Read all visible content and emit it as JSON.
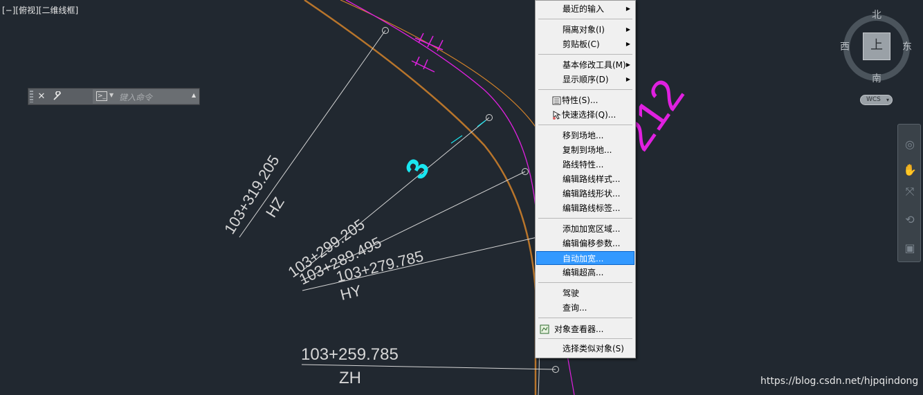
{
  "viewport": {
    "label": "[−][俯视][二维线框]"
  },
  "drawing": {
    "labels": [
      {
        "station": "103+319.205",
        "type": "HZ"
      },
      {
        "station": "103+299.205"
      },
      {
        "station": "103+289.495"
      },
      {
        "station": "103+279.785",
        "type": "HY"
      },
      {
        "station": "103+259.785",
        "type": "ZH"
      }
    ],
    "annotations": {
      "magenta_number": "212",
      "cyan_mark": "3"
    },
    "colors": {
      "background": "#212830",
      "leader_lines": "#d6d6d6",
      "road_orange": "#d2822a",
      "road_magenta": "#e020e0",
      "cyan": "#19e6f0"
    }
  },
  "command_line": {
    "close_icon": "close-icon",
    "settings_icon": "wrench-icon",
    "prompt_icon": "prompt-icon",
    "placeholder": "键入命令"
  },
  "context_menu": {
    "items": [
      {
        "label": "最近的输入",
        "submenu": true
      },
      {
        "label": "隔离对象(I)",
        "submenu": true
      },
      {
        "label": "剪贴板(C)",
        "submenu": true
      },
      {
        "label": "基本修改工具(M)",
        "submenu": true
      },
      {
        "label": "显示顺序(D)",
        "submenu": true
      },
      {
        "label": "特性(S)...",
        "icon": "properties-icon"
      },
      {
        "label": "快速选择(Q)...",
        "icon": "quick-select-icon"
      },
      {
        "label": "移到场地..."
      },
      {
        "label": "复制到场地..."
      },
      {
        "label": "路线特性..."
      },
      {
        "label": "编辑路线样式..."
      },
      {
        "label": "编辑路线形状..."
      },
      {
        "label": "编辑路线标签..."
      },
      {
        "label": "添加加宽区域..."
      },
      {
        "label": "编辑偏移参数..."
      },
      {
        "label": "自动加宽...",
        "highlighted": true
      },
      {
        "label": "编辑超高..."
      },
      {
        "label": "驾驶"
      },
      {
        "label": "查询..."
      },
      {
        "label": "对象查看器...",
        "icon": "object-viewer-icon"
      },
      {
        "label": "选择类似对象(S)"
      }
    ]
  },
  "viewcube": {
    "north": "北",
    "south": "南",
    "east": "东",
    "west": "西",
    "face": "上",
    "ucs": "WCS"
  },
  "navigation_bar": {
    "tools": [
      "steering-wheel-icon",
      "pan-icon",
      "zoom-extents-icon",
      "orbit-icon",
      "showmotion-icon"
    ]
  },
  "watermark": "https://blog.csdn.net/hjpqindong"
}
